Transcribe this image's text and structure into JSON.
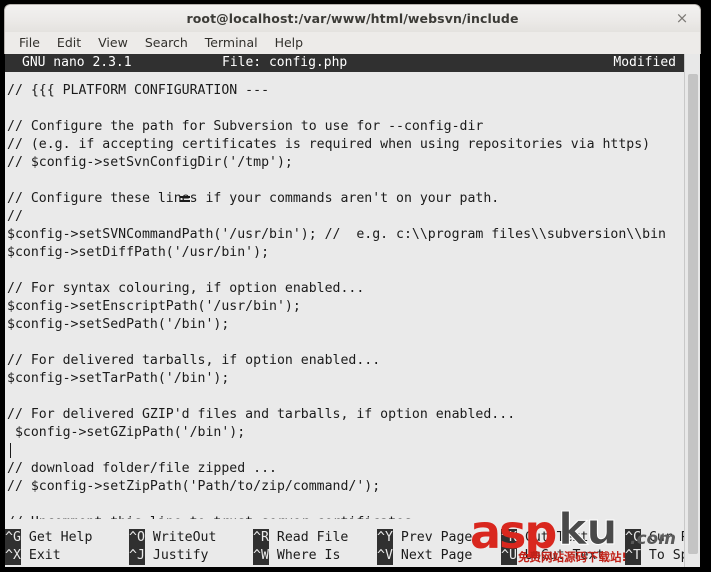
{
  "window": {
    "title": "root@localhost:/var/www/html/websvn/include",
    "close_label": "×"
  },
  "menubar": {
    "items": [
      {
        "label": "File"
      },
      {
        "label": "Edit"
      },
      {
        "label": "View"
      },
      {
        "label": "Search"
      },
      {
        "label": "Terminal"
      },
      {
        "label": "Help"
      }
    ]
  },
  "nano": {
    "version": "GNU nano 2.3.1",
    "file_label": "File: config.php",
    "status": "Modified",
    "lines": [
      "// {{{ PLATFORM CONFIGURATION ---",
      "",
      "// Configure the path for Subversion to use for --config-dir",
      "// (e.g. if accepting certificates is required when using repositories via https)",
      "// $config->setSvnConfigDir('/tmp');",
      "",
      "// Configure these lines if your commands aren't on your path.",
      "//",
      "$config->setSVNCommandPath('/usr/bin'); //  e.g. c:\\\\program files\\\\subversion\\\\bin",
      "$config->setDiffPath('/usr/bin');",
      "",
      "// For syntax colouring, if option enabled...",
      "$config->setEnscriptPath('/usr/bin');",
      "$config->setSedPath('/bin');",
      "",
      "// For delivered tarballs, if option enabled...",
      "$config->setTarPath('/bin');",
      "",
      "// For delivered GZIP'd files and tarballs, if option enabled...",
      " $config->setGZipPath('/bin');",
      "",
      "// download folder/file zipped ...",
      "// $config->setZipPath('Path/to/zip/command/');",
      "",
      "// Uncomment this line to trust server certificates",
      ""
    ],
    "cursor_line_index": 20,
    "shortcuts_row1": [
      {
        "key": "^G",
        "label": "Get Help"
      },
      {
        "key": "^O",
        "label": "WriteOut"
      },
      {
        "key": "^R",
        "label": "Read File"
      },
      {
        "key": "^Y",
        "label": "Prev Page"
      },
      {
        "key": "^K",
        "label": "Cut Text"
      },
      {
        "key": "^C",
        "label": "Cur Pos"
      }
    ],
    "shortcuts_row2": [
      {
        "key": "^X",
        "label": "Exit"
      },
      {
        "key": "^J",
        "label": "Justify"
      },
      {
        "key": "^W",
        "label": "Where Is"
      },
      {
        "key": "^V",
        "label": "Next Page"
      },
      {
        "key": "^U",
        "label": "UnCut Text"
      },
      {
        "key": "^T",
        "label": "To Spell"
      }
    ]
  },
  "watermark": {
    "asp": "asp",
    "ku": "ku",
    "com": ".com",
    "tagline": "免费网站源码下载站!"
  },
  "colors": {
    "terminal_bg": "#eaeaea",
    "terminal_fg": "#1b1b1b",
    "nano_bar_bg": "#303030",
    "nano_bar_fg": "#ffffff",
    "watermark_red": "#d9271e"
  }
}
